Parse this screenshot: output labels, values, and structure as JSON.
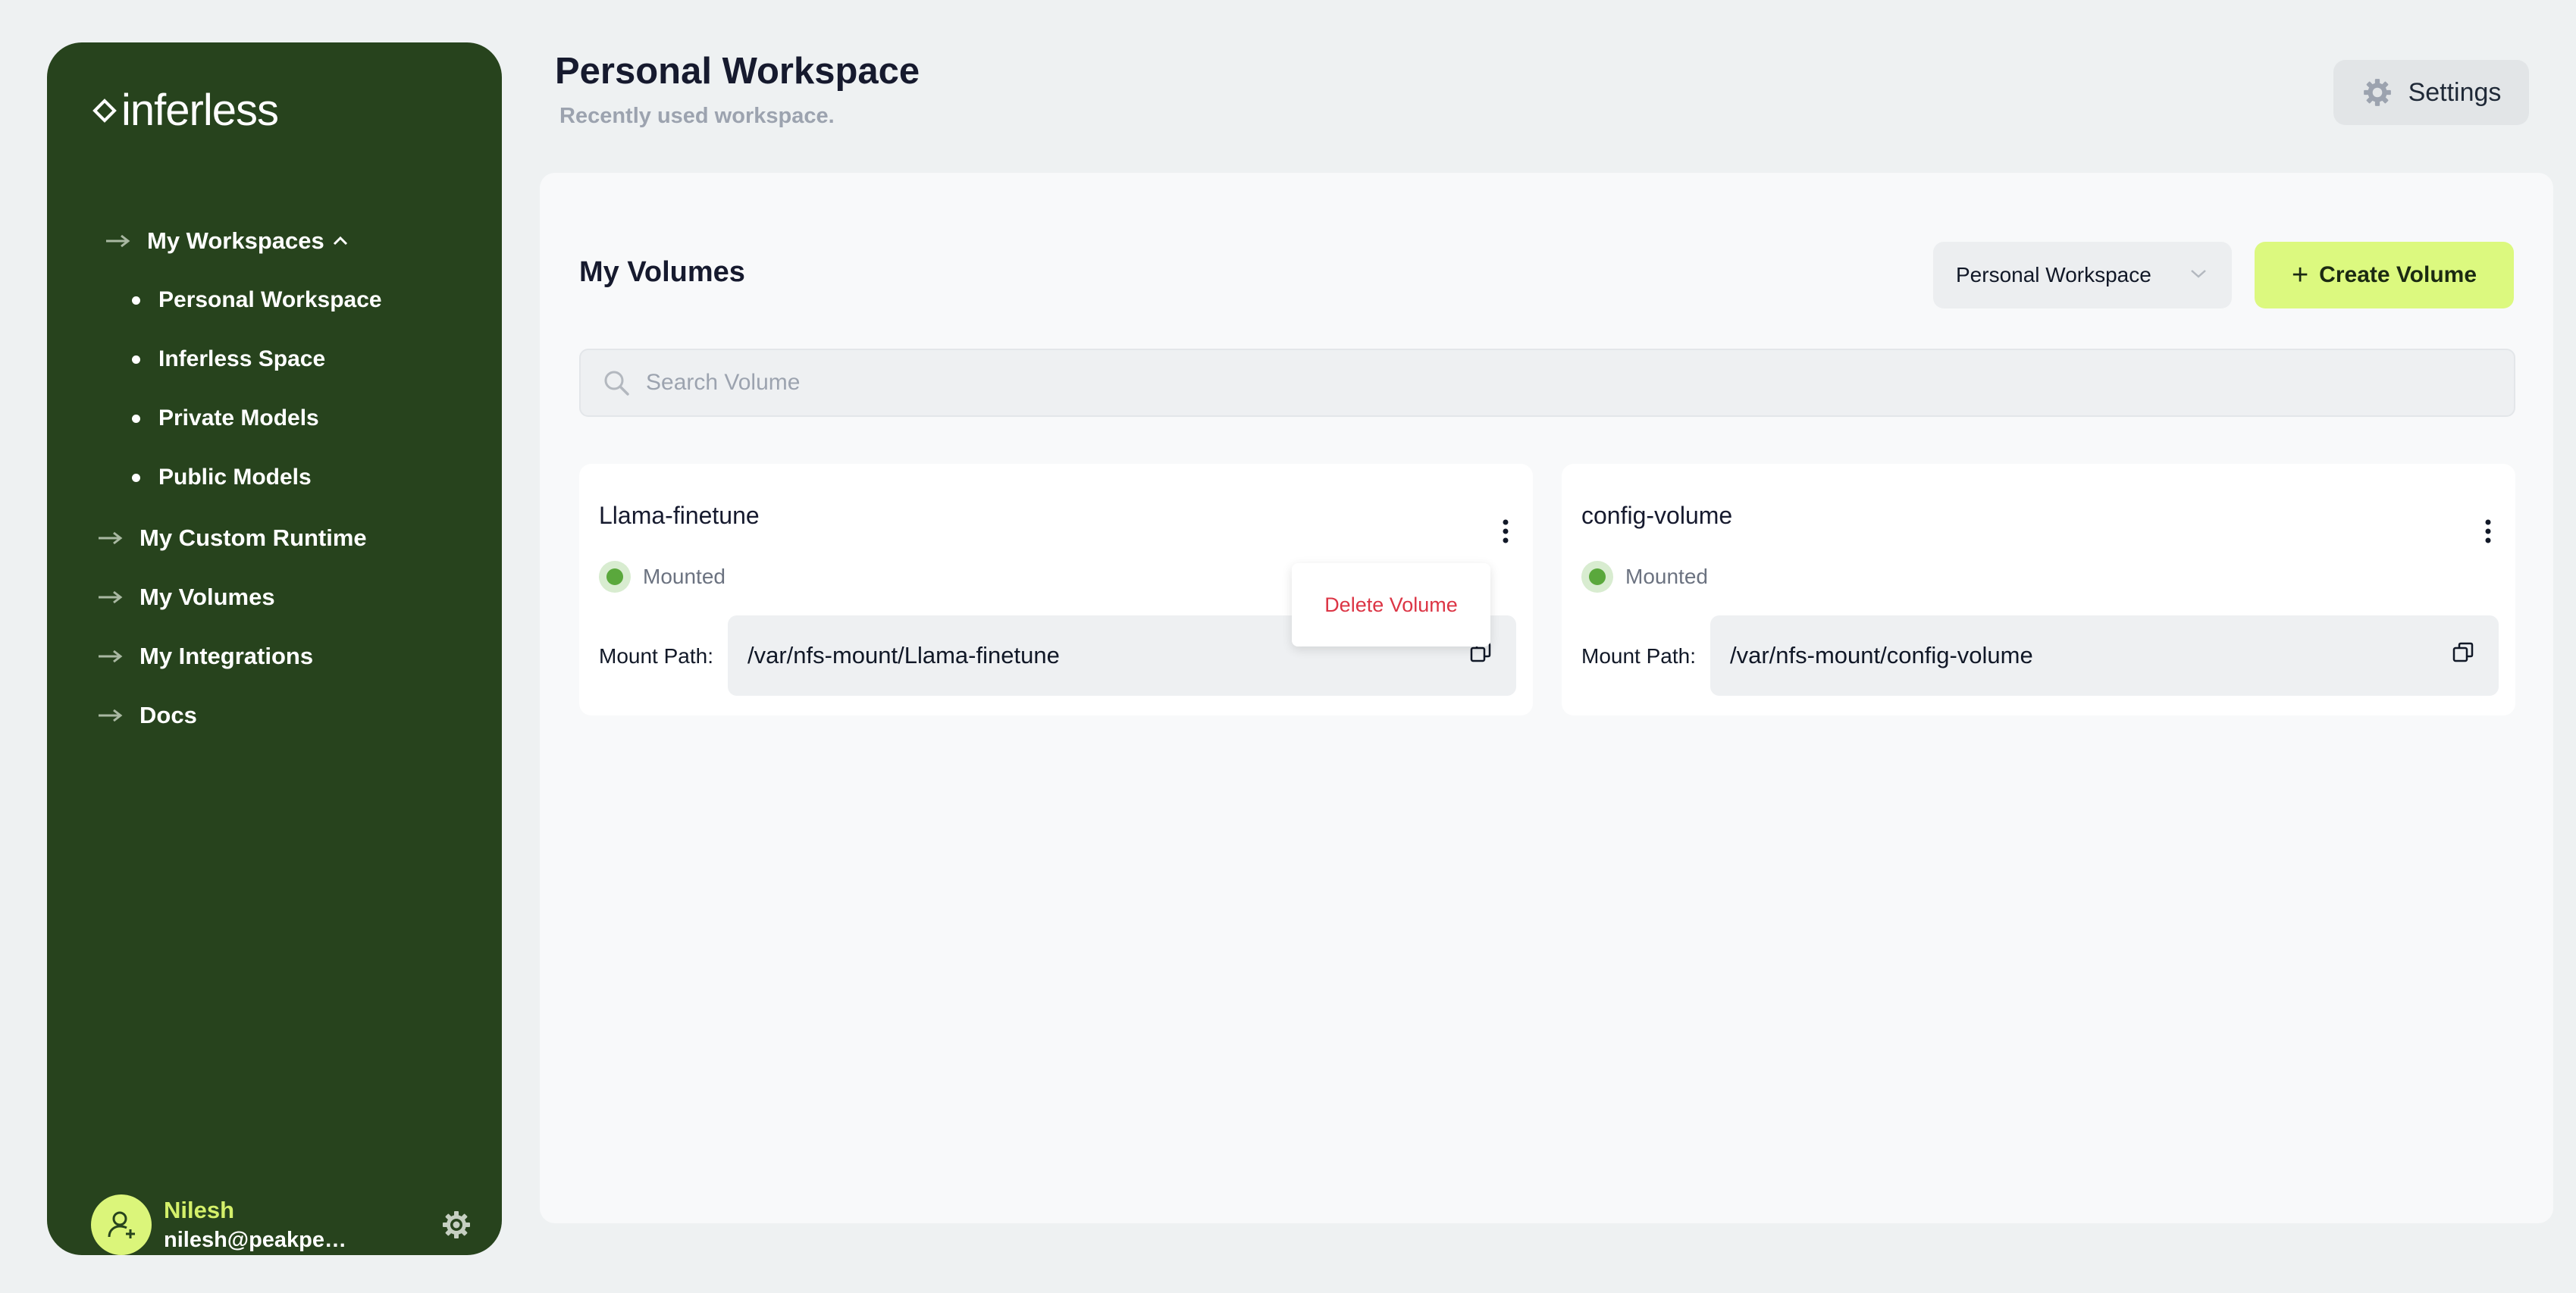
{
  "sidebar": {
    "logo_text": "inferless",
    "nav": {
      "workspaces": "My Workspaces",
      "sub_items": [
        "Personal Workspace",
        "Inferless Space",
        "Private Models",
        "Public Models"
      ],
      "custom_runtime": "My Custom Runtime",
      "volumes": "My Volumes",
      "integrations": "My Integrations",
      "docs": "Docs"
    },
    "user": {
      "name": "Nilesh",
      "email": "nilesh@peakperf..."
    }
  },
  "header": {
    "title": "Personal Workspace",
    "subtitle": "Recently used workspace.",
    "settings_label": "Settings"
  },
  "main": {
    "section_title": "My Volumes",
    "workspace_select": "Personal Workspace",
    "create_button": "Create Volume",
    "create_plus": "+",
    "search_placeholder": "Search Volume",
    "mount_label": "Mount Path:",
    "volumes": [
      {
        "name": "Llama-finetune",
        "status": "Mounted",
        "mount_path": "/var/nfs-mount/Llama-finetune"
      },
      {
        "name": "config-volume",
        "status": "Mounted",
        "mount_path": "/var/nfs-mount/config-volume"
      }
    ],
    "menu": {
      "delete": "Delete Volume"
    }
  },
  "colors": {
    "sidebar_bg": "#27431d",
    "accent": "#dcf97f",
    "status_green": "#5aa83c",
    "danger": "#dc3545"
  },
  "icons": [
    "logo-mark-icon",
    "arrow-right-icon",
    "chevron-up-icon",
    "user-add-icon",
    "gear-icon",
    "chevron-down-icon",
    "plus-icon",
    "search-icon",
    "kebab-icon",
    "copy-icon"
  ]
}
